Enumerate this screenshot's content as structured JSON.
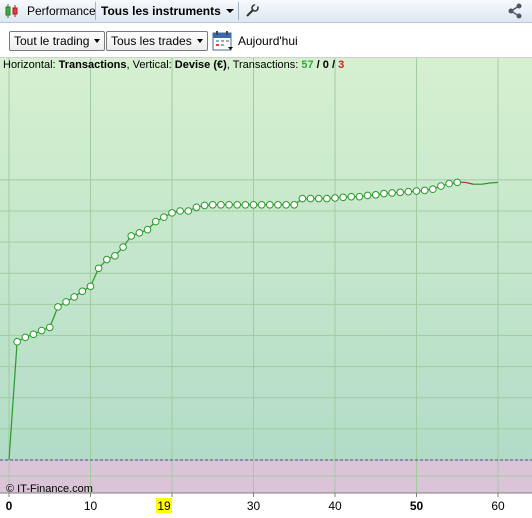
{
  "toolbar": {
    "performance_label": "Performance",
    "instruments_label": "Tous les instruments",
    "icons": [
      "candlestick-icon",
      "chevron-down-icon",
      "wrench-icon",
      "share-icon"
    ]
  },
  "filters": {
    "trading_label": "Tout le trading",
    "trades_label": "Tous les trades",
    "today_label": "Aujourd'hui"
  },
  "info": {
    "prefix": "Horizontal: ",
    "horizontal": "Transactions",
    "mid": ", Vertical: ",
    "vertical": "Devise (€)",
    "trans_prefix": ", Transactions: ",
    "wins": "57",
    "slash1": " / ",
    "even": "0",
    "slash2": " / ",
    "losses": "3"
  },
  "copyright": "© IT-Finance.com",
  "highlight_label": "19",
  "colors": {
    "positive_bg_top": "#d6f0d0",
    "positive_bg_bottom": "#b2dcc8",
    "negative_bg": "#dcc4d8",
    "grid": "#a0cca0",
    "line_win": "#2a9a2a",
    "line_loss": "#c03030",
    "zero_line": "#4a4aa0",
    "highlight": "#ffff00"
  },
  "chart_data": {
    "type": "line",
    "x_ticks": [
      0,
      10,
      20,
      30,
      40,
      50,
      60
    ],
    "x_tick_labels": [
      "0",
      "10",
      "",
      "30",
      "40",
      "50",
      "60"
    ],
    "bold_tick_labels": [
      "0",
      "50"
    ],
    "xlim": [
      -1,
      64
    ],
    "grid": true,
    "x": [
      0,
      1,
      2,
      3,
      4,
      5,
      6,
      7,
      8,
      9,
      10,
      11,
      12,
      13,
      14,
      15,
      16,
      17,
      18,
      19,
      20,
      21,
      22,
      23,
      24,
      25,
      26,
      27,
      28,
      29,
      30,
      31,
      32,
      33,
      34,
      35,
      36,
      37,
      38,
      39,
      40,
      41,
      42,
      43,
      44,
      45,
      46,
      47,
      48,
      49,
      50,
      51,
      52,
      53,
      54,
      55,
      56,
      57,
      58,
      59,
      60
    ],
    "y": [
      0,
      190,
      197,
      202,
      208,
      213,
      246,
      254,
      262,
      271,
      279,
      308,
      322,
      328,
      342,
      360,
      365,
      370,
      383,
      390,
      397,
      400,
      400,
      406,
      409,
      410,
      410,
      410,
      410,
      410,
      410,
      410,
      410,
      410,
      410,
      410,
      420,
      420,
      420,
      420,
      421,
      422,
      423,
      423,
      425,
      426,
      428,
      429,
      430,
      431,
      432,
      433,
      435,
      440,
      444,
      446,
      446,
      443,
      443,
      445,
      446
    ],
    "markers_until_index": 55,
    "loss_segments": [
      [
        55,
        57
      ]
    ],
    "ylim": [
      -40,
      480
    ]
  }
}
